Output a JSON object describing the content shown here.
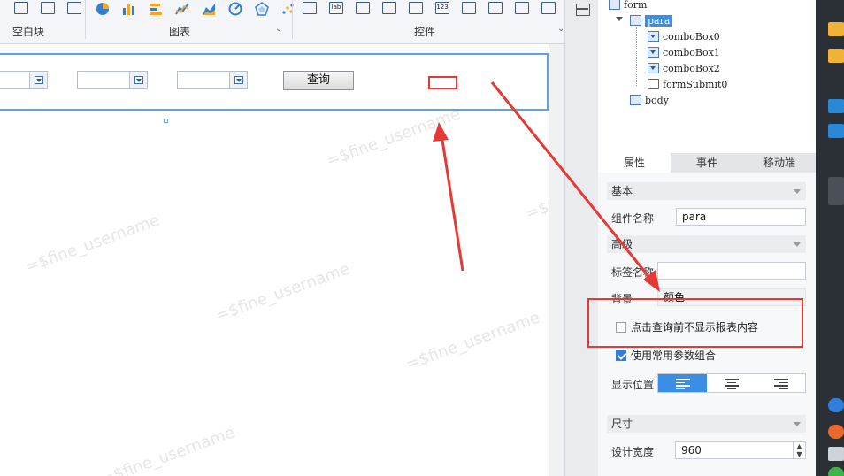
{
  "toolbar": {
    "group_blank": "空白块",
    "group_chart": "图表",
    "group_widget": "控件"
  },
  "form": {
    "query_button": "查询"
  },
  "watermark": "=$fine_username",
  "tree": {
    "items": [
      {
        "label": "form"
      },
      {
        "label": "para"
      },
      {
        "label": "comboBox0"
      },
      {
        "label": "comboBox1"
      },
      {
        "label": "comboBox2"
      },
      {
        "label": "formSubmit0"
      },
      {
        "label": "body"
      }
    ]
  },
  "tabs": [
    {
      "label": "属性"
    },
    {
      "label": "事件"
    },
    {
      "label": "移动端"
    }
  ],
  "props": {
    "section_basic": "基本",
    "component_name_label": "组件名称",
    "component_name_value": "para",
    "section_advanced": "高级",
    "tag_name_label": "标签名称",
    "background_label": "背景",
    "background_value": "颜色",
    "hide_before_query": "点击查询前不显示报表内容",
    "use_common_params": "使用常用参数组合",
    "display_position_label": "显示位置",
    "section_size": "尺寸",
    "design_width_label": "设计宽度",
    "design_width_value": "960"
  },
  "colors": {
    "accent": "#3a8ee6",
    "annotation": "#e53935"
  }
}
